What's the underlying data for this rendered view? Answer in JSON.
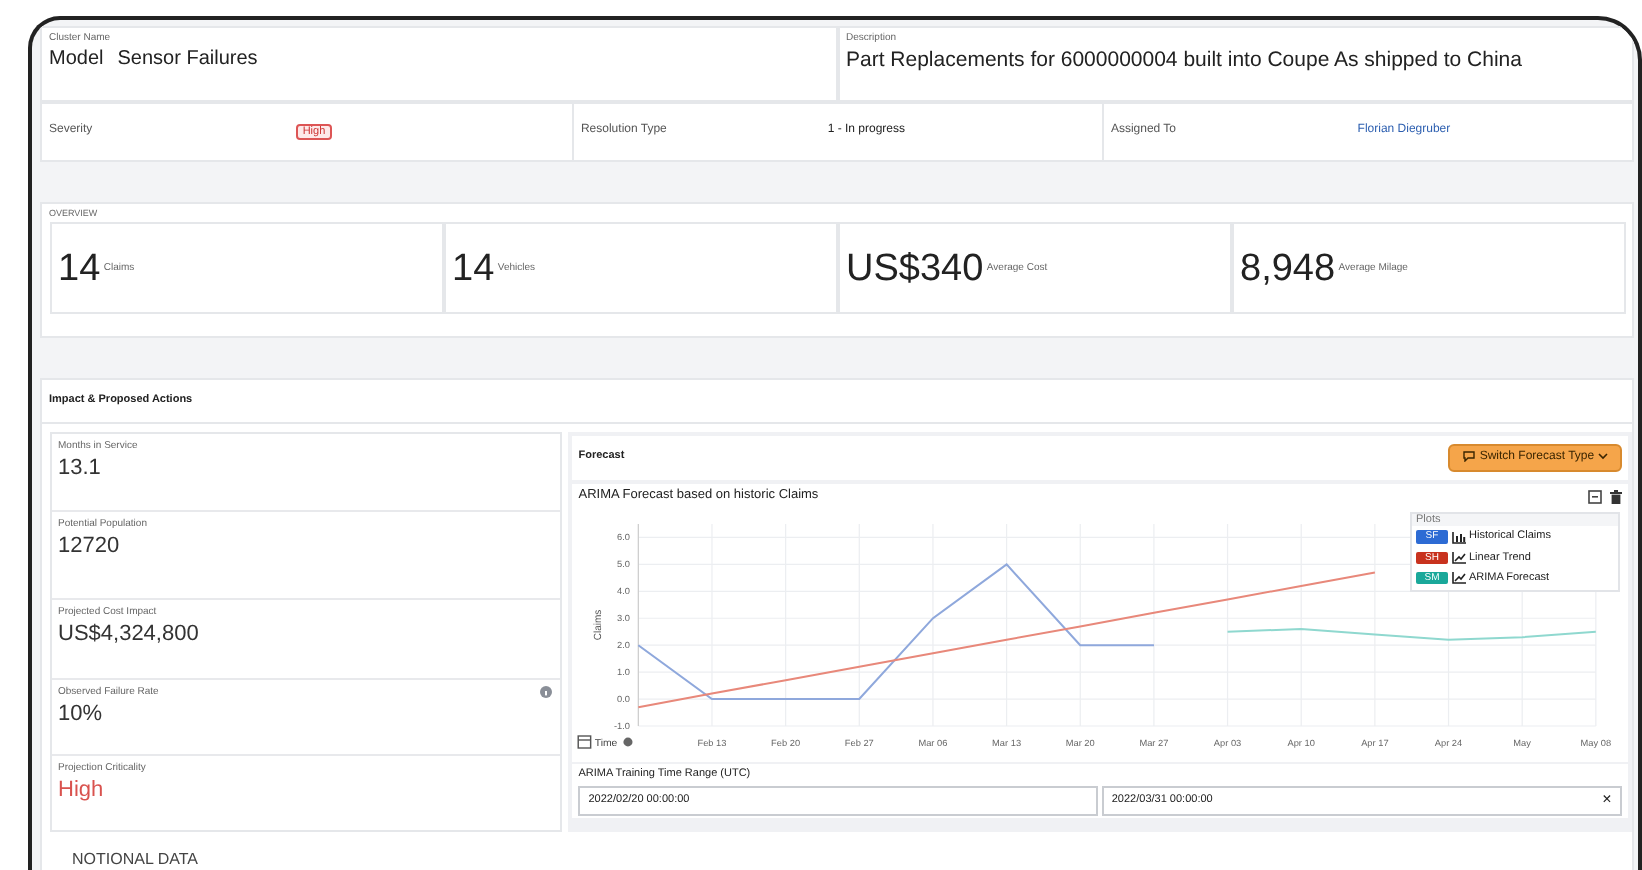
{
  "header": {
    "cluster_name": {
      "label": "Cluster Name",
      "values": [
        "Model",
        "Sensor Failures"
      ]
    },
    "description": {
      "label": "Description",
      "value": "Part Replacements for 6000000004 built into Coupe As shipped to China"
    }
  },
  "details": [
    {
      "label": "Severity",
      "value": "High",
      "kind": "tag"
    },
    {
      "label": "Resolution Type",
      "value": "1 - In progress",
      "kind": "text"
    },
    {
      "label": "Assigned To",
      "value": "Florian Diegruber",
      "kind": "link"
    }
  ],
  "overview": {
    "title": "OVERVIEW",
    "stats": [
      {
        "value": "14",
        "label": "Claims"
      },
      {
        "value": "14",
        "label": "Vehicles"
      },
      {
        "value": "US$340",
        "label": "Average Cost"
      },
      {
        "value": "8,948",
        "label": "Average Milage"
      }
    ]
  },
  "impact": {
    "title": "Impact & Proposed Actions",
    "metrics": [
      {
        "label": "Months in Service",
        "value": "13.1",
        "info": false,
        "alert": false
      },
      {
        "label": "Potential Population",
        "value": "12720",
        "info": false,
        "alert": false
      },
      {
        "label": "Projected Cost Impact",
        "value": "US$4,324,800",
        "info": false,
        "alert": false
      },
      {
        "label": "Observed Failure Rate",
        "value": "10%",
        "info": true,
        "alert": false
      },
      {
        "label": "Projection Criticality",
        "value": "High",
        "info": false,
        "alert": true
      }
    ]
  },
  "forecast": {
    "title": "Forecast",
    "button": "Switch Forecast Type",
    "chart_title": "ARIMA Forecast based on historic Claims",
    "legend_title": "Plots",
    "legend": [
      {
        "tag": "SF",
        "color": "#2d6bd4"
      },
      {
        "tag": "SH",
        "color": "#c8321e"
      },
      {
        "tag": "SM",
        "color": "#1aa89a"
      }
    ],
    "x_axis_label": "Time",
    "chart_data": {
      "type": "line",
      "ylabel": "Claims",
      "categories": [
        null,
        "Feb 13",
        "Feb 20",
        "Feb 27",
        "Mar 06",
        "Mar 13",
        "Mar 20",
        "Mar 27",
        "Apr 03",
        "Apr 10",
        "Apr 17",
        "Apr 24",
        "May",
        "May 08"
      ],
      "series": [
        {
          "name": "Historical Claims",
          "color": "#8fa8dc",
          "values": [
            2,
            0,
            0,
            0,
            3,
            5,
            2,
            2,
            null,
            null,
            null,
            null,
            null,
            null
          ]
        },
        {
          "name": "Linear Trend",
          "color": "#e8887a",
          "values": [
            -0.3,
            0.2,
            0.7,
            1.2,
            1.7,
            2.2,
            2.7,
            3.2,
            3.7,
            4.2,
            4.7,
            null,
            null,
            null
          ]
        },
        {
          "name": "ARIMA Forecast",
          "color": "#8fd8cf",
          "values": [
            null,
            null,
            null,
            null,
            null,
            null,
            null,
            null,
            2.5,
            2.6,
            2.4,
            2.2,
            2.3,
            2.5
          ]
        }
      ],
      "ylim": [
        -1,
        6.5
      ],
      "grid": true,
      "yticks": [
        {
          "value": -1,
          "label": "-1.0"
        },
        {
          "value": 0,
          "label": "0.0"
        },
        {
          "value": 1,
          "label": "1.0"
        },
        {
          "value": 2,
          "label": "2.0"
        },
        {
          "value": 3,
          "label": "3.0"
        },
        {
          "value": 4,
          "label": "4.0"
        },
        {
          "value": 5,
          "label": "5.0"
        },
        {
          "value": 6,
          "label": "6.0"
        }
      ]
    },
    "range": {
      "label": "ARIMA Training Time Range (UTC)",
      "start": "2022/02/20 00:00:00",
      "end": "2022/03/31 00:00:00",
      "clear": "×"
    }
  },
  "footer": "NOTIONAL DATA"
}
